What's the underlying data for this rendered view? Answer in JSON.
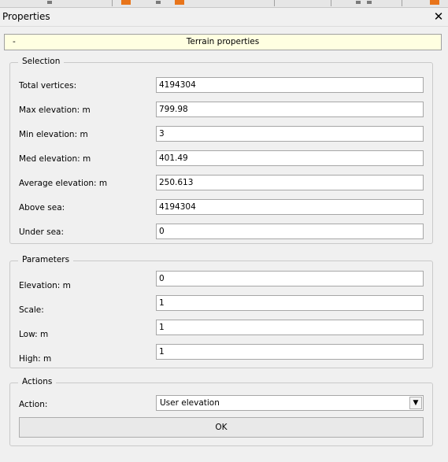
{
  "window": {
    "title": "Properties",
    "close_glyph": "✕",
    "close_icon": "close-icon"
  },
  "panel": {
    "collapse_glyph": "-",
    "title": "Terrain properties"
  },
  "selection": {
    "legend": "Selection",
    "rows": [
      {
        "label": "Total vertices:",
        "value": "4194304"
      },
      {
        "label": "Max elevation: m",
        "value": "799.98"
      },
      {
        "label": "Min elevation: m",
        "value": "3"
      },
      {
        "label": "Med elevation: m",
        "value": "401.49"
      },
      {
        "label": "Average elevation: m",
        "value": "250.613"
      },
      {
        "label": "Above sea:",
        "value": "4194304"
      },
      {
        "label": "Under sea:",
        "value": "0"
      }
    ]
  },
  "parameters": {
    "legend": "Parameters",
    "rows": [
      {
        "label": "Elevation: m",
        "value": "0"
      },
      {
        "label": "Scale:",
        "value": "1"
      },
      {
        "label": "Low: m",
        "value": "1"
      },
      {
        "label": "High: m",
        "value": "1"
      }
    ]
  },
  "actions": {
    "legend": "Actions",
    "action_label": "Action:",
    "action_value": "User elevation",
    "dropdown_glyph": "▼",
    "ok_label": "OK"
  }
}
